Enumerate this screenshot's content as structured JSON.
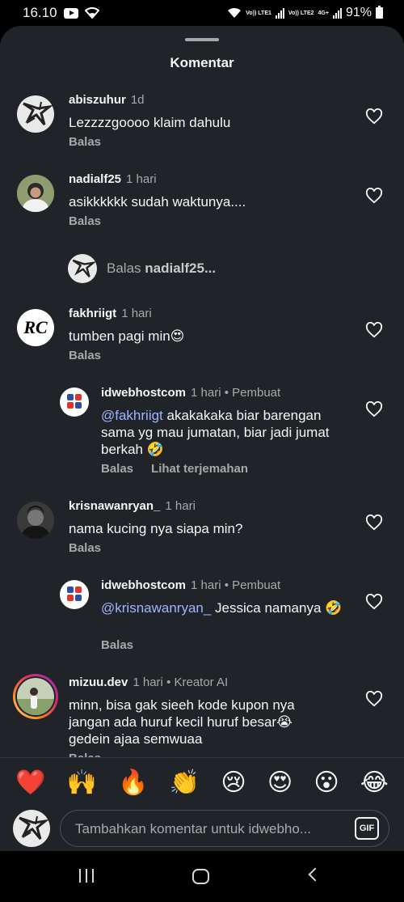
{
  "status_bar": {
    "time": "16.10",
    "network_1": "Vo)) LTE1",
    "network_2": "Vo)) LTE2",
    "network_3": "4G+",
    "battery": "91%"
  },
  "sheet": {
    "title": "Komentar"
  },
  "comments": [
    {
      "username": "abiszuhur",
      "time": "1d",
      "text": "Lezzzzgoooo klaim dahulu",
      "reply_label": "Balas"
    },
    {
      "username": "nadialf25",
      "time": "1 hari",
      "text": "asikkkkkk sudah waktunya....",
      "reply_label": "Balas"
    },
    {
      "username": "fakhriigt",
      "time": "1 hari",
      "text": "tumben pagi min😍",
      "reply_label": "Balas"
    },
    {
      "username": "idwebhostcom",
      "time": "1 hari",
      "badge": "• Pembuat",
      "mention": "@fakhriigt",
      "text": " akakakaka biar barengan sama yg mau jumatan, biar jadi jumat berkah 🤣",
      "reply_label": "Balas",
      "translate_label": "Lihat terjemahan"
    },
    {
      "username": "krisnawanryan_",
      "time": "1 hari",
      "text": "nama kucing nya siapa min?",
      "reply_label": "Balas"
    },
    {
      "username": "idwebhostcom",
      "time": "1 hari",
      "badge": "• Pembuat",
      "mention": "@krisnawanryan_",
      "text": " Jessica namanya 🤣",
      "reply_label": "Balas"
    },
    {
      "username": "mizuu.dev",
      "time": "1 hari",
      "badge": "• Kreator AI",
      "text": "minn, bisa gak sieeh kode kupon nya jangan ada huruf kecil huruf besar😭 gedein ajaa semwuaa",
      "reply_label": "Balas"
    }
  ],
  "reply_prompt": {
    "prefix": "Balas",
    "username": "nadialf25..."
  },
  "emoji_bar": [
    "❤️",
    "🙌",
    "🔥",
    "👏",
    "😢",
    "😍",
    "😮",
    "😂"
  ],
  "input": {
    "placeholder": "Tambahkan komentar untuk idwebho...",
    "gif_label": "GIF"
  },
  "colors": {
    "sheet_bg": "#202429",
    "text": "#f5f5f5",
    "secondary_text": "#a8a8a8",
    "mention": "#9db5ff",
    "story_ring": "#d62976"
  }
}
